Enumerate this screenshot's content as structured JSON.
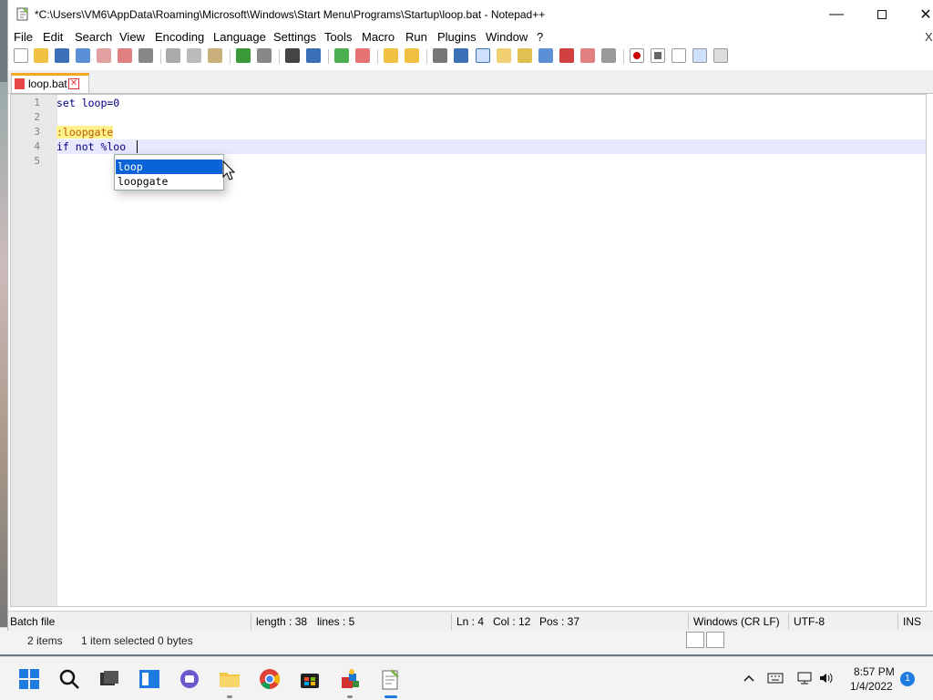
{
  "window": {
    "title": "*C:\\Users\\VM6\\AppData\\Roaming\\Microsoft\\Windows\\Start Menu\\Programs\\Startup\\loop.bat - Notepad++",
    "app_icon": "notepadpp-icon"
  },
  "menu": [
    "File",
    "Edit",
    "Search",
    "View",
    "Encoding",
    "Language",
    "Settings",
    "Tools",
    "Macro",
    "Run",
    "Plugins",
    "Window",
    "?"
  ],
  "menu_close": "X",
  "tab": {
    "label": "loop.bat",
    "close_glyph": "✕"
  },
  "editor": {
    "line_numbers": [
      "1",
      "2",
      "3",
      "4",
      "5"
    ],
    "lines": [
      "set loop=0",
      "",
      ":loopgate",
      "if not %loo",
      ""
    ]
  },
  "autocomplete": [
    "loop",
    "loopgate"
  ],
  "status": {
    "language": "Batch file",
    "length": "length : 38",
    "lines": "lines : 5",
    "ln": "Ln : 4",
    "col": "Col : 12",
    "pos": "Pos : 37",
    "eol": "Windows (CR LF)",
    "encoding": "UTF-8",
    "mode": "INS"
  },
  "explorer_status": {
    "items": "2 items",
    "selected": "1 item selected  0 bytes"
  },
  "tray": {
    "time": "8:57 PM",
    "date": "1/4/2022",
    "notification_count": "1"
  },
  "colors": {
    "accent": "#0a64d8",
    "label_highlight": "#fff28c",
    "current_line": "#e8e8ff",
    "tab_accent": "#f5a623"
  }
}
